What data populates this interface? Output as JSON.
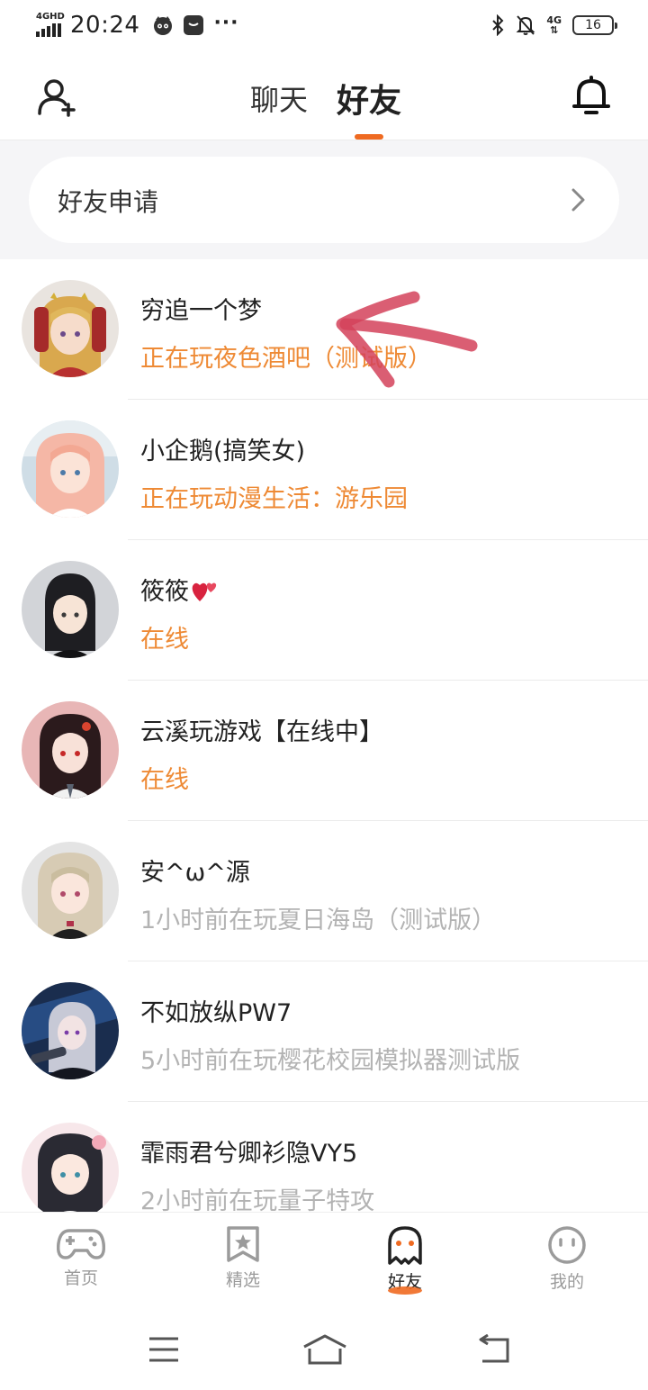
{
  "status_bar": {
    "network": "4GHD",
    "time": "20:24",
    "mobile_data": "4G",
    "battery": "16"
  },
  "header": {
    "tabs": [
      {
        "label": "聊天",
        "active": false
      },
      {
        "label": "好友",
        "active": true
      }
    ],
    "accent_color": "#ef6a21"
  },
  "friend_request": {
    "label": "好友申请"
  },
  "friends": [
    {
      "name": "穷追一个梦",
      "status": "正在玩夜色酒吧（测试版）",
      "status_color": "#ee8a35",
      "avatar_icon": "anime-girl-blonde-avatar"
    },
    {
      "name": "小企鹅(搞笑女)",
      "status": "正在玩动漫生活：游乐园",
      "status_color": "#ee8a35",
      "avatar_icon": "anime-girl-pink-avatar"
    },
    {
      "name": "筱筱",
      "status": "在线",
      "status_color": "#ee8a35",
      "avatar_icon": "anime-girl-black-hair-avatar"
    },
    {
      "name": "云溪玩游戏【在线中】",
      "status": "在线",
      "status_color": "#ee8a35",
      "avatar_icon": "anime-girl-red-eyes-avatar"
    },
    {
      "name": "安^ω^源",
      "status": "1小时前在玩夏日海岛（测试版）",
      "status_color": "#b3b3b3",
      "avatar_icon": "anime-girl-silver-avatar"
    },
    {
      "name": "不如放纵PW7",
      "status": "5小时前在玩樱花校园模拟器测试版",
      "status_color": "#b3b3b3",
      "avatar_icon": "anime-girl-blue-avatar"
    },
    {
      "name": "霏雨君兮卿衫隐VY5",
      "status": "2小时前在玩量子特攻",
      "status_color": "#b3b3b3",
      "avatar_icon": "anime-girl-dark-hair-avatar"
    }
  ],
  "bottom_nav": [
    {
      "label": "首页",
      "icon": "gamepad-icon",
      "active": false
    },
    {
      "label": "精选",
      "icon": "star-bookmark-icon",
      "active": false
    },
    {
      "label": "好友",
      "icon": "ghost-icon",
      "active": true
    },
    {
      "label": "我的",
      "icon": "face-icon",
      "active": false
    }
  ]
}
